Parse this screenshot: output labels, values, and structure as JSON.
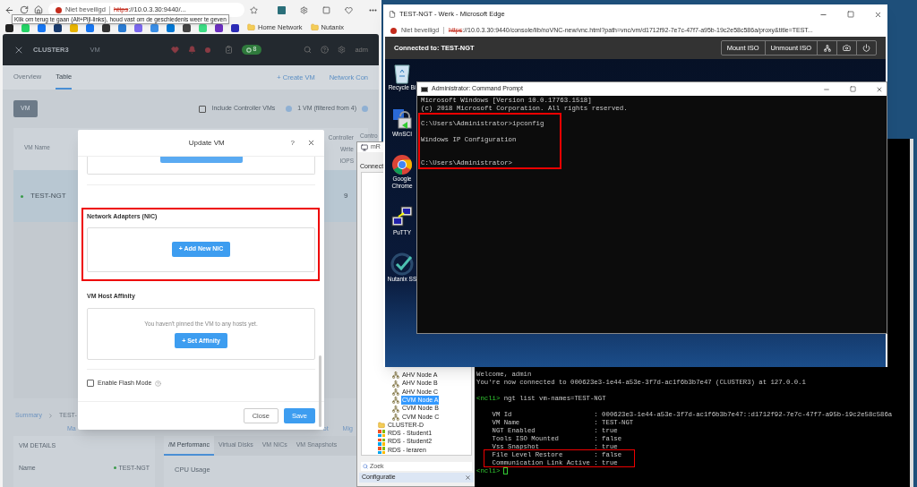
{
  "browser": {
    "tooltip": "Klik om terug te gaan (Alt+Pijl-links), houd vast om de geschiedenis weer te geven",
    "security": "Niet beveiligd",
    "url_scheme": "https",
    "url_rest": "://10.0.3.30:9440/...",
    "bookmarks": [
      {
        "label": "Home Network"
      },
      {
        "label": "Nutanix"
      }
    ]
  },
  "prism": {
    "cluster": "CLUSTER3",
    "entity": "VM",
    "task_count": "8",
    "user": "adm",
    "nav_tabs": [
      {
        "label": "Overview",
        "selected": false
      },
      {
        "label": "Table",
        "selected": true
      }
    ],
    "actions": [
      "+ Create VM",
      "Network Con"
    ],
    "view_button": "VM",
    "include_cvms": {
      "label": "Include Controller VMs",
      "checked": false
    },
    "filter_summary": "1 VM (filtered from 4)",
    "columns": [
      "VM Name",
      "Controller\nWrite\nIOPS",
      "Contro"
    ],
    "row": {
      "name": "TEST-NGT",
      "value": "9"
    },
    "breadcrumb": [
      "Summary",
      "TEST-"
    ],
    "action_fragments": [
      "Ma",
      "ot",
      "Mig"
    ],
    "details_title": "VM DETAILS",
    "details": [
      {
        "label": "Name",
        "value": "TEST-NGT"
      }
    ],
    "detail_tabs": [
      {
        "label": "/M Performanc",
        "selected": true
      },
      {
        "label": "Virtual Disks",
        "selected": false
      },
      {
        "label": "VM NICs",
        "selected": false
      },
      {
        "label": "VM Snapshots",
        "selected": false
      }
    ],
    "chart_title": "CPU Usage"
  },
  "modal": {
    "title": "Update VM",
    "help": "?",
    "nic_title": "Network Adapters (NIC)",
    "add_nic": "+ Add New NIC",
    "affinity_title": "VM Host Affinity",
    "affinity_empty": "You haven't pinned the VM to any hosts yet.",
    "set_affinity": "+ Set Affinity",
    "flash_mode": {
      "label": "Enable Flash Mode",
      "checked": false
    },
    "buttons": [
      {
        "label": "Close",
        "kind": "secondary"
      },
      {
        "label": "Save",
        "kind": "primary"
      }
    ]
  },
  "console_window": {
    "title": "TEST-NGT - Werk - Microsoft Edge",
    "security": "Niet beveiligd",
    "url_scheme": "https",
    "url_rest": "://10.0.3.30:9440/console/lib/noVNC-new/vnc.html?path=vnc/vm/d1712f92-7e7c-47f7-a95b-19c2e58c586a/proxy&title=TEST...",
    "connected": "Connected to: TEST-NGT",
    "toolbar": [
      {
        "kind": "text",
        "label": "Mount ISO"
      },
      {
        "kind": "text",
        "label": "Unmount ISO"
      },
      {
        "kind": "network"
      },
      {
        "kind": "camera"
      },
      {
        "kind": "power"
      }
    ],
    "desktop_icons": [
      {
        "kind": "bin",
        "label": "Recycle Bi"
      },
      {
        "kind": "winscp",
        "label": "WinSCI"
      },
      {
        "kind": "chrome",
        "label": "Google\nChrome"
      },
      {
        "kind": "putty",
        "label": "PuTTY"
      },
      {
        "kind": "nutanix",
        "label": "Nutanix SS"
      }
    ],
    "cmd": {
      "title": "Administrator: Command Prompt",
      "lines": [
        {
          "kind": "text",
          "text": "Microsoft Windows [Version 10.0.17763.1518]"
        },
        {
          "kind": "text",
          "text": "(c) 2018 Microsoft Corporation. All rights reserved."
        },
        {
          "kind": "blank"
        },
        {
          "kind": "text",
          "text": "C:\\Users\\Administrator>ipconfig"
        },
        {
          "kind": "blank"
        },
        {
          "kind": "text",
          "text": "Windows IP Configuration"
        },
        {
          "kind": "blank"
        },
        {
          "kind": "blank"
        },
        {
          "kind": "text",
          "text": "C:\\Users\\Administrator>"
        }
      ]
    }
  },
  "mremote": {
    "title": "mR",
    "panel": "Connect",
    "tree": [
      {
        "label": "AHV Node A",
        "kind": "host",
        "selected": false
      },
      {
        "label": "AHV Node B",
        "kind": "host",
        "selected": false
      },
      {
        "label": "AHV Node C",
        "kind": "host",
        "selected": false
      },
      {
        "label": "CVM Node A",
        "kind": "host",
        "selected": true
      },
      {
        "label": "CVM Node B",
        "kind": "host",
        "selected": false
      },
      {
        "label": "CVM Node C",
        "kind": "host",
        "selected": false
      },
      {
        "label": "CLUSTER-D",
        "kind": "folder",
        "selected": false
      },
      {
        "label": "RDS - Student1",
        "kind": "rdp",
        "selected": false
      },
      {
        "label": "RDS - Student2",
        "kind": "rdp",
        "selected": false
      },
      {
        "label": "RDS - leraren",
        "kind": "rdp",
        "selected": false
      }
    ],
    "search": "Zoek",
    "config": "Configuratie"
  },
  "terminal": {
    "lines": [
      {
        "kind": "text",
        "text": "Welcome, admin"
      },
      {
        "kind": "text",
        "text": "You're now connected to 000623e3-1e44-a53e-3f7d-ac1f6b3b7e47 (CLUSTER3) at 127.0.0.1"
      },
      {
        "kind": "blank"
      },
      {
        "kind": "prompt",
        "prompt": "<ncli>",
        "text": " ngt list vm-names=TEST-NGT"
      },
      {
        "kind": "blank"
      },
      {
        "kind": "text",
        "text": "    VM Id                     : 000623e3-1e44-a53e-3f7d-ac1f6b3b7e47::d1712f92-7e7c-47f7-a95b-19c2e58c586a"
      },
      {
        "kind": "text",
        "text": "    VM Name                   : TEST-NGT"
      },
      {
        "kind": "text",
        "text": "    NGT Enabled               : true"
      },
      {
        "kind": "text",
        "text": "    Tools ISO Mounted         : false"
      },
      {
        "kind": "text",
        "text": "    Vss Snapshot              : true"
      },
      {
        "kind": "text",
        "text": "    File Level Restore        : false"
      },
      {
        "kind": "text",
        "text": "    Communication Link Active : true"
      },
      {
        "kind": "prompt",
        "prompt": "<ncli>",
        "cursor": true
      }
    ]
  }
}
